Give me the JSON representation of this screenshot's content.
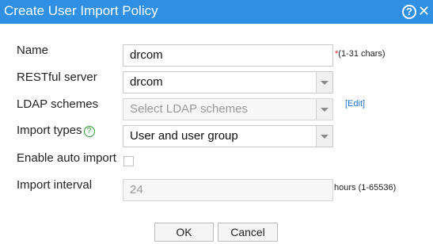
{
  "dialog": {
    "title": "Create User Import Policy",
    "help_icon": "?",
    "close_icon": "✕"
  },
  "form": {
    "name": {
      "label": "Name",
      "value": "drcom",
      "required_mark": "*",
      "hint": "(1-31 chars)"
    },
    "restful": {
      "label": "RESTful server",
      "value": "drcom"
    },
    "ldap": {
      "label": "LDAP schemes",
      "placeholder": "Select LDAP schemes",
      "edit_link": "[Edit]"
    },
    "import_types": {
      "label": "Import types",
      "info_icon": "?",
      "value": "User and user group"
    },
    "auto_import": {
      "label": "Enable auto import",
      "checked": false
    },
    "interval": {
      "label": "Import interval",
      "value": "24",
      "hint": "hours (1-65536)"
    }
  },
  "buttons": {
    "ok": "OK",
    "cancel": "Cancel"
  },
  "colors": {
    "titlebar": "#2f8fe3",
    "required": "#e02020",
    "link": "#1a6fc8",
    "info_icon": "#30a030"
  }
}
